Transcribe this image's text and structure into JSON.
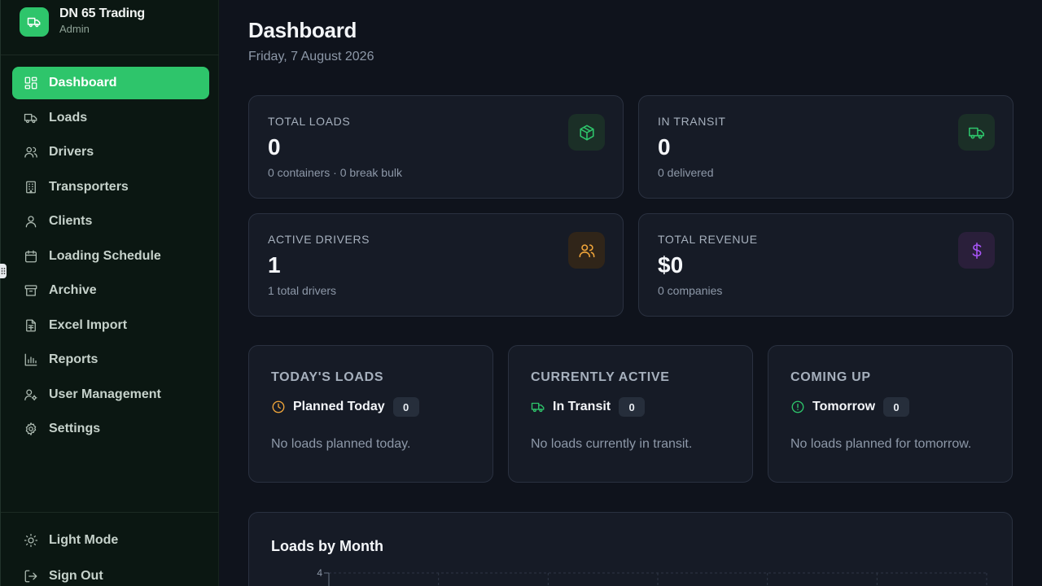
{
  "brand": {
    "name": "DN 65 Trading",
    "role": "Admin"
  },
  "nav": [
    {
      "label": "Dashboard",
      "icon": "dashboard-icon",
      "active": true
    },
    {
      "label": "Loads",
      "icon": "truck-icon"
    },
    {
      "label": "Drivers",
      "icon": "users-icon"
    },
    {
      "label": "Transporters",
      "icon": "building-icon"
    },
    {
      "label": "Clients",
      "icon": "user-icon"
    },
    {
      "label": "Loading Schedule",
      "icon": "calendar-icon"
    },
    {
      "label": "Archive",
      "icon": "archive-icon"
    },
    {
      "label": "Excel Import",
      "icon": "file-spreadsheet-icon"
    },
    {
      "label": "Reports",
      "icon": "bar-chart-icon"
    },
    {
      "label": "User Management",
      "icon": "user-cog-icon"
    },
    {
      "label": "Settings",
      "icon": "gear-icon"
    }
  ],
  "bottom": {
    "light_mode": "Light Mode",
    "sign_out": "Sign Out"
  },
  "header": {
    "title": "Dashboard",
    "date": "Friday, 7 August 2026"
  },
  "stats": {
    "total_loads": {
      "label": "Total Loads",
      "value": "0",
      "sub": "0 containers · 0 break bulk",
      "icon": "package-icon"
    },
    "in_transit": {
      "label": "In Transit",
      "value": "0",
      "sub": "0 delivered",
      "icon": "truck-icon"
    },
    "active_drivers": {
      "label": "Active Drivers",
      "value": "1",
      "sub": "1 total drivers",
      "icon": "users-icon"
    },
    "total_revenue": {
      "label": "Total Revenue",
      "value": "$0",
      "sub": "0 companies",
      "icon": "dollar-icon"
    }
  },
  "panels": {
    "today": {
      "title": "Today's Loads",
      "row_label": "Planned Today",
      "count": "0",
      "empty": "No loads planned today.",
      "icon": "clock-icon"
    },
    "active": {
      "title": "Currently Active",
      "row_label": "In Transit",
      "count": "0",
      "empty": "No loads currently in transit.",
      "icon": "truck-icon"
    },
    "upcoming": {
      "title": "Coming Up",
      "row_label": "Tomorrow",
      "count": "0",
      "empty": "No loads planned for tomorrow.",
      "icon": "alert-circle-icon"
    }
  },
  "colors": {
    "accent": "#2ec56b",
    "orange": "#f0a53a",
    "purple": "#a855f7"
  },
  "chart_data": {
    "type": "bar",
    "title": "Loads by Month",
    "xlabel": "",
    "ylabel": "",
    "ylim": [
      0,
      4
    ],
    "yticks": [
      "4"
    ],
    "grid": true,
    "categories": [],
    "values": []
  }
}
